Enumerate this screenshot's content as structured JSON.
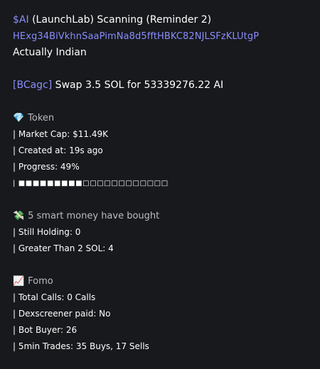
{
  "header": {
    "ticker": "$AI",
    "title_rest": " (LaunchLab) Scanning (Reminder 2)",
    "contract_address": "HExg34BiVkhnSaaPimNa8d5fftHBKC82NJLSFzKLUtgP",
    "token_name": "Actually Indian"
  },
  "swap": {
    "wallet_tag": "[BCagc]",
    "text": " Swap 3.5 SOL for 53339276.22 AI"
  },
  "token_section": {
    "icon_char": "💎",
    "icon_name": "gem-icon",
    "title": " Token",
    "market_cap": "| Market Cap: $11.49K",
    "created_at": "| Created at: 19s ago",
    "progress": "| Progress: 49%",
    "progress_value": 0.49,
    "progress_bar": "| ■■■■■■■■■□□□□□□□□□□□□"
  },
  "smart_money_section": {
    "icon_char": "💸",
    "icon_name": "money-wings-icon",
    "title": " 5 smart money have bought",
    "still_holding": "| Still Holding: 0",
    "greater_than": "| Greater Than 2 SOL: 4"
  },
  "fomo_section": {
    "icon_char": "📈",
    "icon_name": "chart-up-icon",
    "title": " Fomo",
    "total_calls": "| Total Calls: 0 Calls",
    "dexscreener": "| Dexscreener paid: No",
    "bot_buyer": "| Bot Buyer: 26",
    "trades": "| 5min Trades: 35 Buys, 17 Sells"
  },
  "colors": {
    "background": "#17191c",
    "link": "#8a8dfc",
    "text": "#ffffff",
    "section_title": "#b9bcc3"
  }
}
